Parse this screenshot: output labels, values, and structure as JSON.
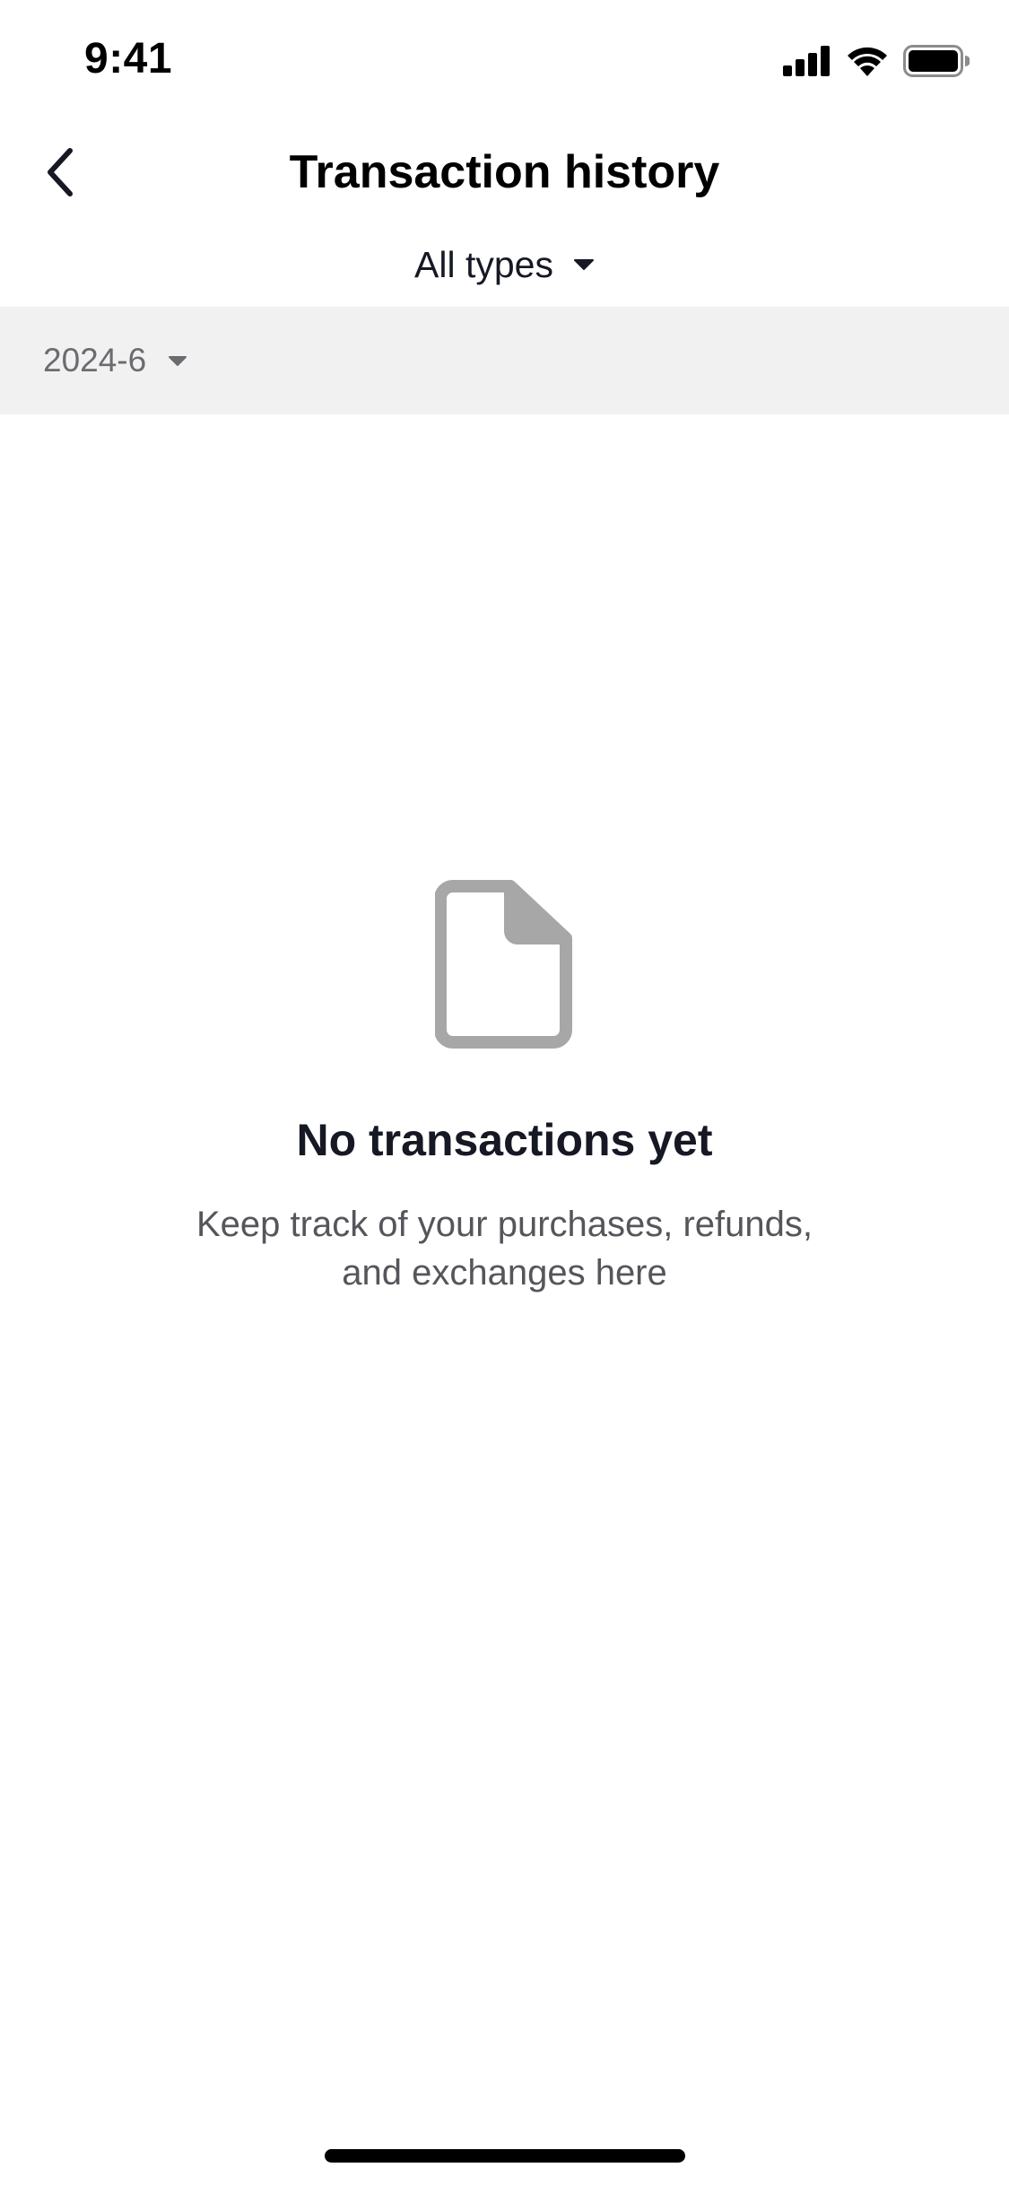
{
  "status_bar": {
    "time": "9:41",
    "icons": [
      "cellular-signal-icon",
      "wifi-icon",
      "battery-icon"
    ]
  },
  "header": {
    "back_icon": "chevron-left-icon",
    "title": "Transaction history"
  },
  "filters": {
    "type_label": "All types",
    "date_label": "2024-6",
    "dropdown_icon": "caret-down-icon"
  },
  "empty_state": {
    "icon": "document-icon",
    "title": "No transactions yet",
    "subtitle": "Keep track of your purchases, refunds, and exchanges here"
  },
  "colors": {
    "background": "#ffffff",
    "date_bar_bg": "#f1f1f2",
    "icon_gray": "#a7a7a8",
    "title_text": "#161823",
    "subtitle_text": "#55555b"
  }
}
